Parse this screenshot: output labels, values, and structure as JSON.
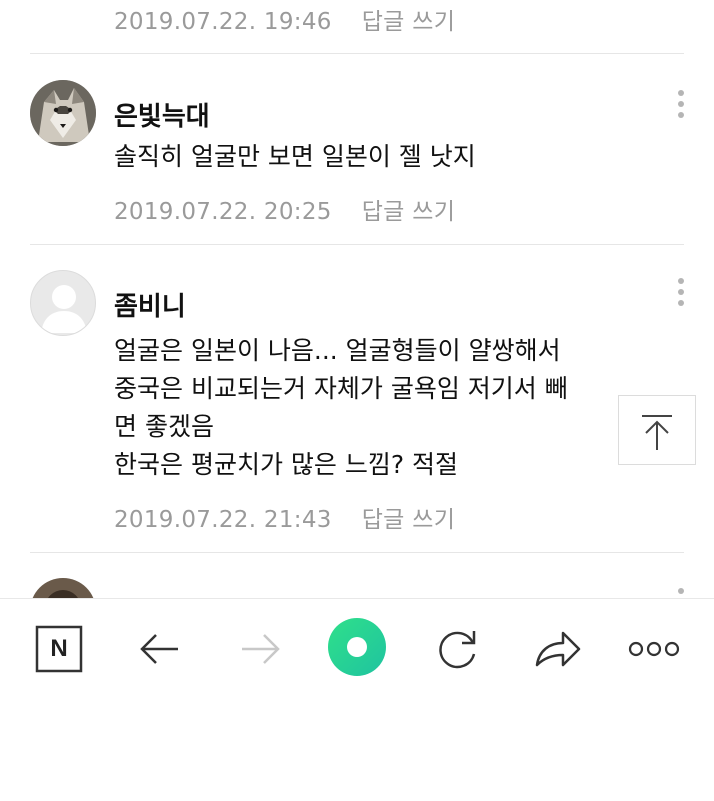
{
  "comments": [
    {
      "timestamp": "2019.07.22. 19:46",
      "reply_label": "답글 쓰기"
    },
    {
      "author": "은빛늑대",
      "lines": [
        "솔직히 얼굴만 보면 일본이 젤 낫지"
      ],
      "timestamp": "2019.07.22. 20:25",
      "reply_label": "답글 쓰기"
    },
    {
      "author": "좀비니",
      "lines": [
        "얼굴은 일본이 나음... 얼굴형들이 얄쌍해서",
        "중국은 비교되는거 자체가 굴욕임 저기서 빼",
        "면 좋겠음",
        "한국은 평균치가 많은 느낌? 적절"
      ],
      "timestamp": "2019.07.22. 21:43",
      "reply_label": "답글 쓰기"
    }
  ],
  "toolbar": {
    "naver_letter": "N",
    "icons": [
      "naver-home-icon",
      "back-arrow-icon",
      "forward-arrow-icon",
      "green-dot-icon",
      "refresh-icon",
      "share-icon",
      "more-options-icon"
    ]
  },
  "colors": {
    "meta_text": "#9a9a9a",
    "divider": "#e6e6e6",
    "green_button": "#21d07a",
    "disabled_icon": "#c8c8c8"
  }
}
